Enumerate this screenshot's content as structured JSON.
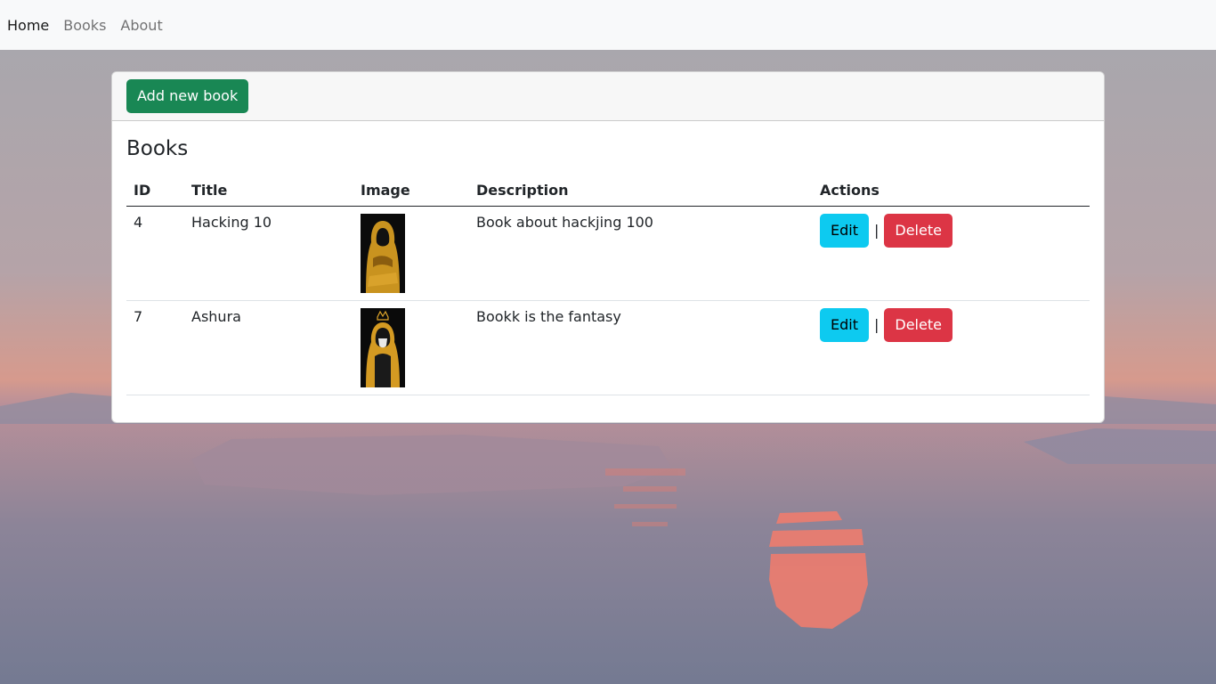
{
  "nav": {
    "items": [
      {
        "label": "Home",
        "active": true
      },
      {
        "label": "Books",
        "active": false
      },
      {
        "label": "About",
        "active": false
      }
    ]
  },
  "card": {
    "add_button_label": "Add new book",
    "title": "Books"
  },
  "table": {
    "headers": [
      "ID",
      "Title",
      "Image",
      "Description",
      "Actions"
    ],
    "rows": [
      {
        "id": "4",
        "title": "Hacking 10",
        "image_icon": "hooded-figure-yellow-image",
        "description": "Book about hackjing 100",
        "edit_label": "Edit",
        "separator": "|",
        "delete_label": "Delete"
      },
      {
        "id": "7",
        "title": "Ashura",
        "image_icon": "hooded-figure-crown-image",
        "description": "Bookk is the fantasy",
        "edit_label": "Edit",
        "separator": "|",
        "delete_label": "Delete"
      }
    ]
  },
  "colors": {
    "success": "#198754",
    "info": "#0dcaf0",
    "danger": "#dc3545",
    "navbar_bg": "#f8f9fa"
  }
}
